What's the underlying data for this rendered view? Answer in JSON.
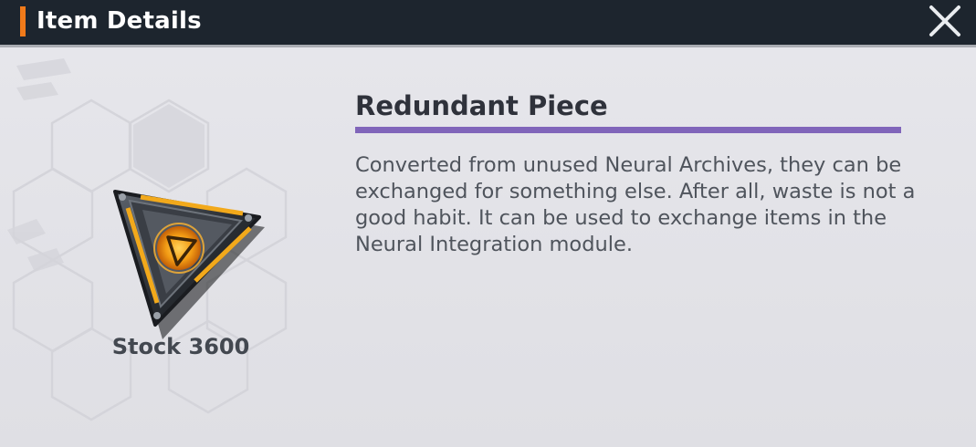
{
  "window": {
    "title": "Item Details",
    "accent_color": "#f07a1a"
  },
  "close_button": {
    "icon": "close-icon"
  },
  "item": {
    "name": "Redundant Piece",
    "name_rule_color": "#8065ba",
    "description": "Converted from unused Neural Archives, they can be exchanged for something else. After all, waste is not a good habit. It can be used to exchange items in the Neural Integration module.",
    "stock_text": "Stock 3600",
    "icon": "triangular-chip-icon",
    "glow_color": "#f7a11b"
  }
}
